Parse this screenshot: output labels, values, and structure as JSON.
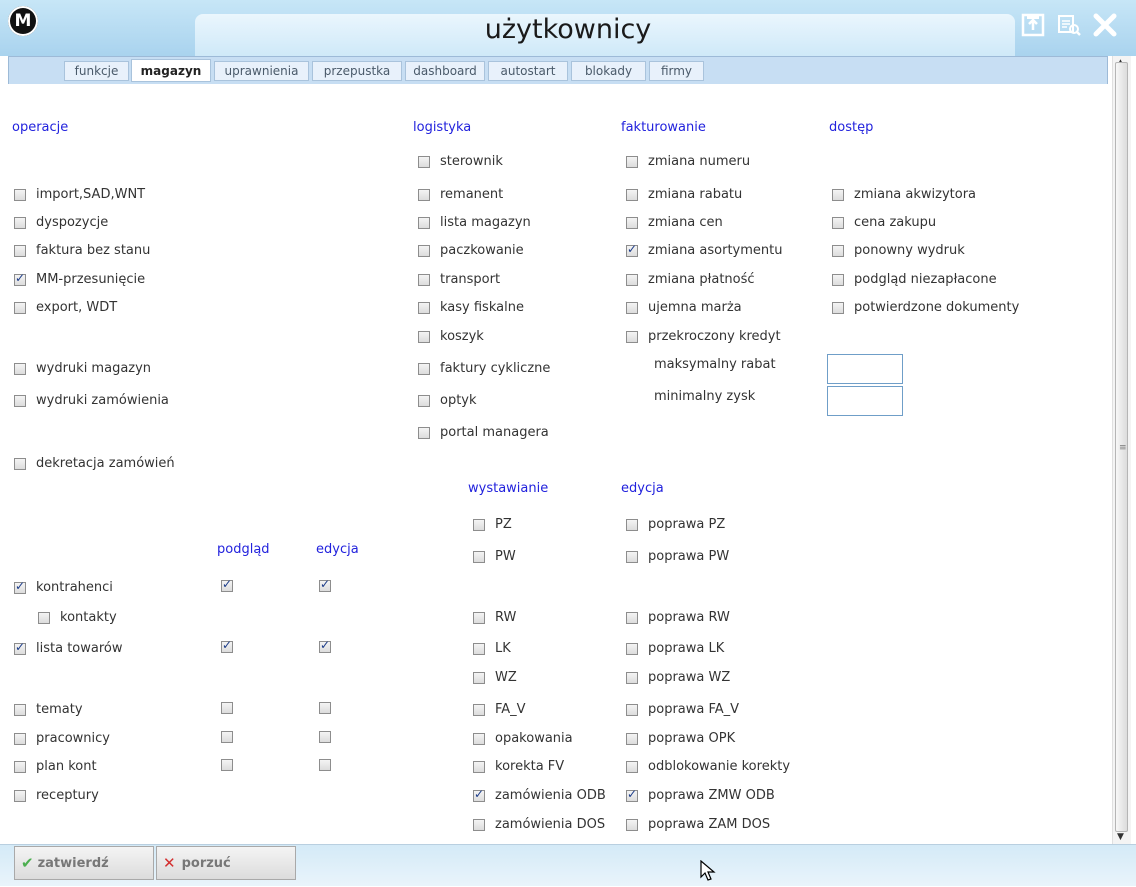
{
  "window": {
    "title": "użytkownicy",
    "logo_text": "M"
  },
  "tabs": [
    {
      "label": "funkcje"
    },
    {
      "label": "magazyn"
    },
    {
      "label": "uprawnienia"
    },
    {
      "label": "przepustka"
    },
    {
      "label": "dashboard"
    },
    {
      "label": "autostart"
    },
    {
      "label": "blokady"
    },
    {
      "label": "firmy"
    }
  ],
  "active_tab": "magazyn",
  "headers": {
    "operacje": "operacje",
    "logistyka": "logistyka",
    "fakturowanie": "fakturowanie",
    "dostep": "dostęp",
    "podglad": "podgląd",
    "edycja": "edycja",
    "wystawianie": "wystawianie",
    "edycja2": "edycja"
  },
  "operacje": [
    {
      "label": "import,SAD,WNT",
      "checked": false
    },
    {
      "label": "dyspozycje",
      "checked": false
    },
    {
      "label": "faktura bez stanu",
      "checked": false
    },
    {
      "label": "MM-przesunięcie",
      "checked": true
    },
    {
      "label": "export, WDT",
      "checked": false
    },
    {
      "label": "wydruki magazyn",
      "checked": false
    },
    {
      "label": "wydruki zamówienia",
      "checked": false
    },
    {
      "label": "dekretacja zamówień",
      "checked": false
    }
  ],
  "logistyka": [
    {
      "label": "sterownik",
      "checked": false
    },
    {
      "label": "remanent",
      "checked": false
    },
    {
      "label": "lista magazyn",
      "checked": false
    },
    {
      "label": "paczkowanie",
      "checked": false
    },
    {
      "label": "transport",
      "checked": false
    },
    {
      "label": "kasy fiskalne",
      "checked": false
    },
    {
      "label": "koszyk",
      "checked": false
    },
    {
      "label": "faktury cykliczne",
      "checked": false
    },
    {
      "label": "optyk",
      "checked": false
    },
    {
      "label": "portal managera",
      "checked": false
    }
  ],
  "fakturowanie": [
    {
      "label": "zmiana numeru",
      "checked": false
    },
    {
      "label": "zmiana rabatu",
      "checked": false
    },
    {
      "label": "zmiana cen",
      "checked": false
    },
    {
      "label": "zmiana asortymentu",
      "checked": true
    },
    {
      "label": "zmiana płatność",
      "checked": false
    },
    {
      "label": "ujemna marża",
      "checked": false
    },
    {
      "label": "przekroczony kredyt",
      "checked": false
    }
  ],
  "fakturowanie_fields": {
    "maks_label": "maksymalny rabat",
    "maks_value": "",
    "min_label": "minimalny zysk",
    "min_value": ""
  },
  "dostep": [
    {
      "label": "zmiana akwizytora",
      "checked": false
    },
    {
      "label": "cena zakupu",
      "checked": false
    },
    {
      "label": "ponowny wydruk",
      "checked": false
    },
    {
      "label": "podgląd niezapłacone",
      "checked": false
    },
    {
      "label": "potwierdzone dokumenty",
      "checked": false
    }
  ],
  "permissions": [
    {
      "label": "kontrahenci",
      "checked": true,
      "podglad": true,
      "edycja": true
    },
    {
      "label": "kontakty",
      "checked": false
    },
    {
      "label": "lista towarów",
      "checked": true,
      "podglad": true,
      "edycja": true
    },
    {
      "label": "tematy",
      "checked": false,
      "podglad": false,
      "edycja": false
    },
    {
      "label": "pracownicy",
      "checked": false,
      "podglad": false,
      "edycja": false
    },
    {
      "label": "plan kont",
      "checked": false,
      "podglad": false,
      "edycja": false
    },
    {
      "label": "receptury",
      "checked": false
    }
  ],
  "wystawianie": [
    {
      "label": "PZ",
      "checked": false
    },
    {
      "label": "PW",
      "checked": false
    },
    {
      "label": "RW",
      "checked": false
    },
    {
      "label": "LK",
      "checked": false
    },
    {
      "label": "WZ",
      "checked": false
    },
    {
      "label": "FA_V",
      "checked": false
    },
    {
      "label": "opakowania",
      "checked": false
    },
    {
      "label": "korekta FV",
      "checked": false
    },
    {
      "label": "zamówienia ODB",
      "checked": true
    },
    {
      "label": "zamówienia DOS",
      "checked": false
    }
  ],
  "edycja_docs": [
    {
      "label": "poprawa PZ",
      "checked": false
    },
    {
      "label": "poprawa PW",
      "checked": false
    },
    {
      "label": "poprawa RW",
      "checked": false
    },
    {
      "label": "poprawa LK",
      "checked": false
    },
    {
      "label": "poprawa WZ",
      "checked": false
    },
    {
      "label": "poprawa FA_V",
      "checked": false
    },
    {
      "label": "poprawa OPK",
      "checked": false
    },
    {
      "label": "odblokowanie korekty",
      "checked": false
    },
    {
      "label": "poprawa ZMW ODB",
      "checked": true
    },
    {
      "label": "poprawa ZAM DOS",
      "checked": false
    }
  ],
  "footer": {
    "confirm_label": "zatwierdź",
    "cancel_label": "porzuć"
  },
  "colors": {
    "header_blue": "#2222dd",
    "confirm_green": "#4caf50",
    "cancel_red": "#d32f2f"
  }
}
